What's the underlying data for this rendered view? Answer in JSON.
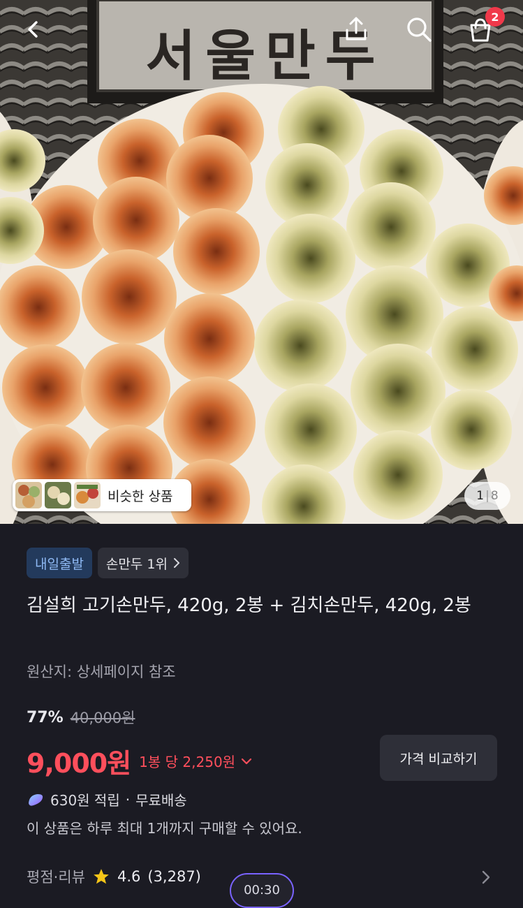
{
  "header": {
    "back_icon": "chevron-left-icon",
    "share_icon": "share-icon",
    "search_icon": "search-icon",
    "cart_icon": "shopping-bag-icon",
    "cart_count": "2"
  },
  "hero": {
    "sign_text": "서울만두",
    "similar_label": "비슷한 상품",
    "pager": {
      "current": "1",
      "separator": "|",
      "total": "8"
    }
  },
  "product": {
    "tags": {
      "primary": "내일출발",
      "ranking": "손만두 1위"
    },
    "title": "김설희 고기손만두, 420g, 2봉 + 김치손만두, 420g, 2봉",
    "origin": "원산지: 상세페이지 참조",
    "discount": "77%",
    "original_price": "40,000원",
    "price": "9,000원",
    "unit_price": "1봉 당 2,250원",
    "compare_button": "가격 비교하기",
    "reward": "630원 적립",
    "reward_separator": "·",
    "shipping": "무료배송",
    "purchase_limit": "이 상품은 하루 최대 1개까지 구매할 수 있어요.",
    "review_label": "평점·리뷰",
    "rating": "4.6",
    "review_count": "(3,287)",
    "timer": "00:30"
  },
  "colors": {
    "background": "#1b1b23",
    "price_red": "#ff4f5c",
    "tag_blue_bg": "#233a5c",
    "tag_blue_text": "#8fbaf5",
    "badge_red": "#f0394a",
    "timer_border": "#7a63ff"
  }
}
